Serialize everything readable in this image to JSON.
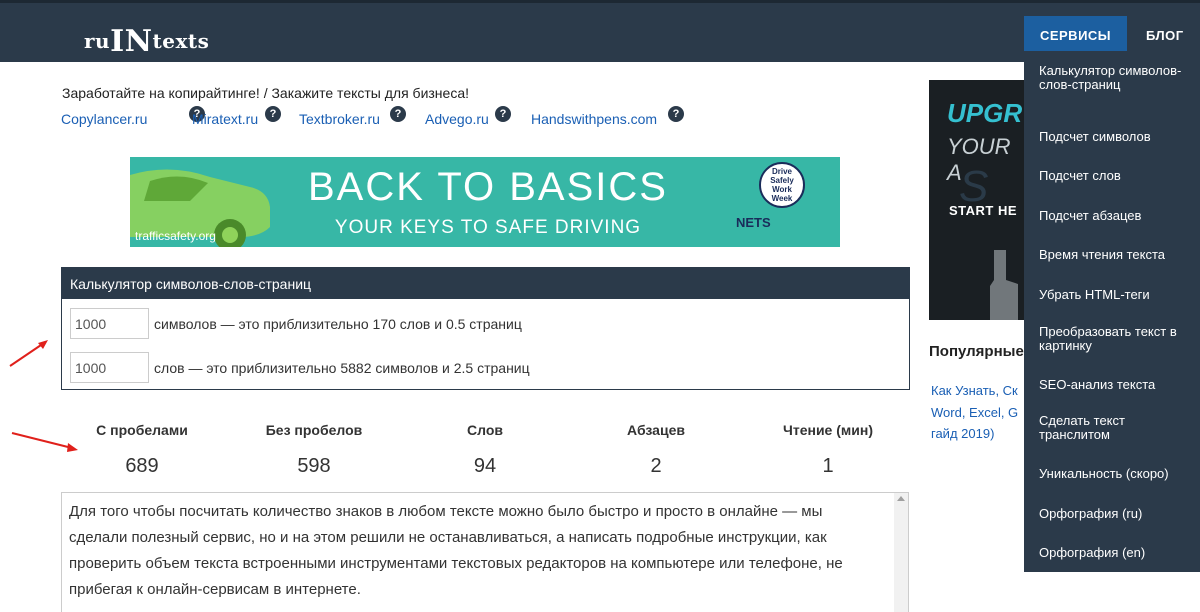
{
  "header": {
    "logo": {
      "part1": "ru",
      "part2": "IN",
      "part3": "texts"
    },
    "nav_services": "СЕРВИСЫ",
    "nav_blog": "БЛОГ"
  },
  "dropdown": [
    "Калькулятор символов-слов-страниц",
    "Подсчет символов",
    "Подсчет слов",
    "Подсчет абзацев",
    "Время чтения текста",
    "Убрать HTML-теги",
    "Преобразовать текст в картинку",
    "SEO-анализ текста",
    "Сделать текст транслитом",
    "Уникальность (скоро)",
    "Орфография (ru)",
    "Орфография (en)"
  ],
  "intro": "Заработайте на копирайтинге! / Закажите тексты для бизнеса!",
  "links": [
    "Copylancer.ru",
    "Miratext.ru",
    "Textbroker.ru",
    "Advego.ru",
    "Handswithpens.com"
  ],
  "help_glyph": "?",
  "banner": {
    "title": "BACK TO BASICS",
    "subtitle": "YOUR KEYS TO SAFE DRIVING",
    "site": "trafficsafety.org",
    "badge": [
      "Drive",
      "Safely",
      "Work",
      "Week"
    ],
    "org": "NETS"
  },
  "calculator": {
    "title": "Калькулятор символов-слов-страниц",
    "row1_value": "1000",
    "row1_text": "символов — это приблизительно 170 слов и 0.5 страниц",
    "row2_value": "1000",
    "row2_text": "слов — это приблизительно 5882 символов и 2.5 страниц"
  },
  "stats": [
    {
      "label": "С пробелами",
      "value": "689"
    },
    {
      "label": "Без пробелов",
      "value": "598"
    },
    {
      "label": "Слов",
      "value": "94"
    },
    {
      "label": "Абзацев",
      "value": "2"
    },
    {
      "label": "Чтение (мин)",
      "value": "1"
    }
  ],
  "textarea": [
    "Для того чтобы посчитать количество знаков в любом тексте можно было быстро и просто в онлайне — мы",
    "сделали полезный сервис, но и на этом решили не останавливаться, а написать подробные инструкции, как",
    "проверить объем текста встроенными инструментами текстовых редакторов на компьютере или телефоне, не",
    "прибегая к онлайн-сервисам в интернете."
  ],
  "ad": {
    "line1": "UPGR",
    "line2": "YOUR A",
    "line3": "START HE"
  },
  "sidebar": {
    "popular_title": "Популярные",
    "popular_link": "Как Узнать, Ск Word, Excel, G гайд 2019)"
  },
  "colors": {
    "header_bg": "#2b3a4a",
    "accent": "#1c5fa0",
    "link": "#1a5fb4",
    "banner_bg": "#37b7a6",
    "arrow": "#e0201b"
  }
}
